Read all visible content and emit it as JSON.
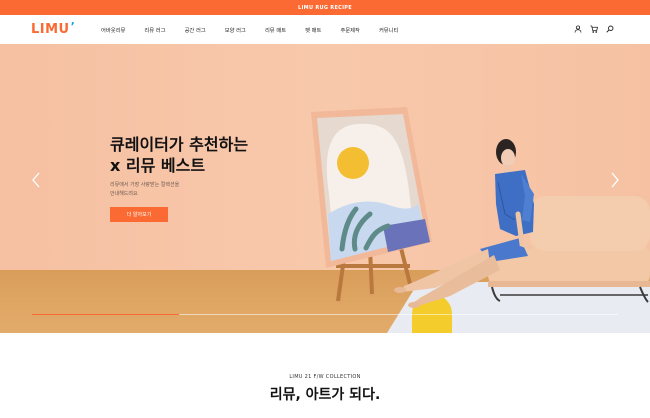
{
  "promo_bar": {
    "text": "LIMU RUG RECIPE"
  },
  "header": {
    "logo": "LIMU",
    "nav": [
      "어바웃리뮤",
      "리뮤 러그",
      "공간 러그",
      "모양 러그",
      "리뮤 매트",
      "펫 매트",
      "주문제작",
      "커뮤니티"
    ],
    "icons": [
      "user-icon",
      "cart-icon",
      "search-icon"
    ]
  },
  "hero": {
    "title_line1": "큐레이터가 추천하는",
    "title_line2": "x 리뮤 베스트",
    "subtitle_line1": "리뮤에서 가장 사랑받는 컬렉션을",
    "subtitle_line2": "안내해드려요",
    "button": "더 알아보기",
    "progress": 0.25,
    "icons": [
      "chevron-left-icon",
      "chevron-right-icon"
    ]
  },
  "collection": {
    "eyebrow": "LIMU 21 F/W COLLECTION",
    "title": "리뮤, 아트가 되다."
  },
  "colors": {
    "accent": "#fb6a32",
    "wall": "#f7c3a5",
    "floor": "#dba05d"
  }
}
